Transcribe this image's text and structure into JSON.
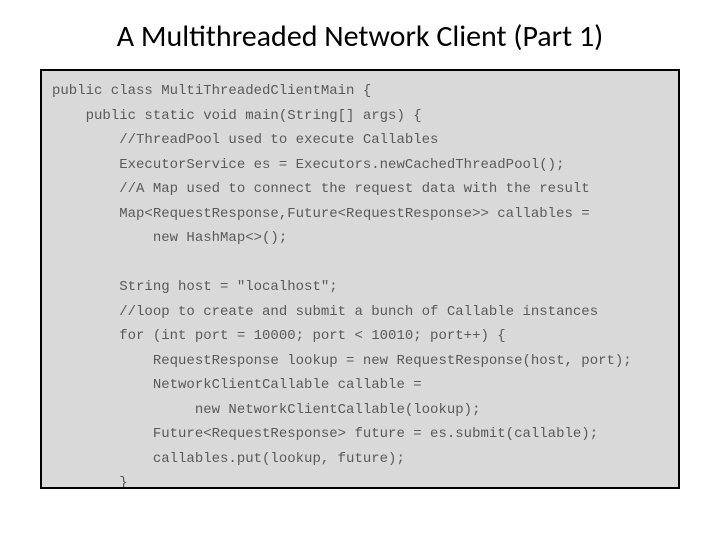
{
  "title": "A Multithreaded Network Client (Part 1)",
  "code": {
    "l01": "public class MultiThreadedClientMain {",
    "l02": "    public static void main(String[] args) {",
    "l03": "        //ThreadPool used to execute Callables",
    "l04": "        ExecutorService es = Executors.newCachedThreadPool();",
    "l05": "        //A Map used to connect the request data with the result",
    "l06": "        Map<RequestResponse,Future<RequestResponse>> callables =",
    "l07": "            new HashMap<>();",
    "l08": "",
    "l09": "        String host = \"localhost\";",
    "l10": "        //loop to create and submit a bunch of Callable instances",
    "l11": "        for (int port = 10000; port < 10010; port++) {",
    "l12": "            RequestResponse lookup = new RequestResponse(host, port);",
    "l13": "            NetworkClientCallable callable =",
    "l14": "                 new NetworkClientCallable(lookup);",
    "l15": "            Future<RequestResponse> future = es.submit(callable);",
    "l16": "            callables.put(lookup, future);",
    "l17": "        }"
  }
}
